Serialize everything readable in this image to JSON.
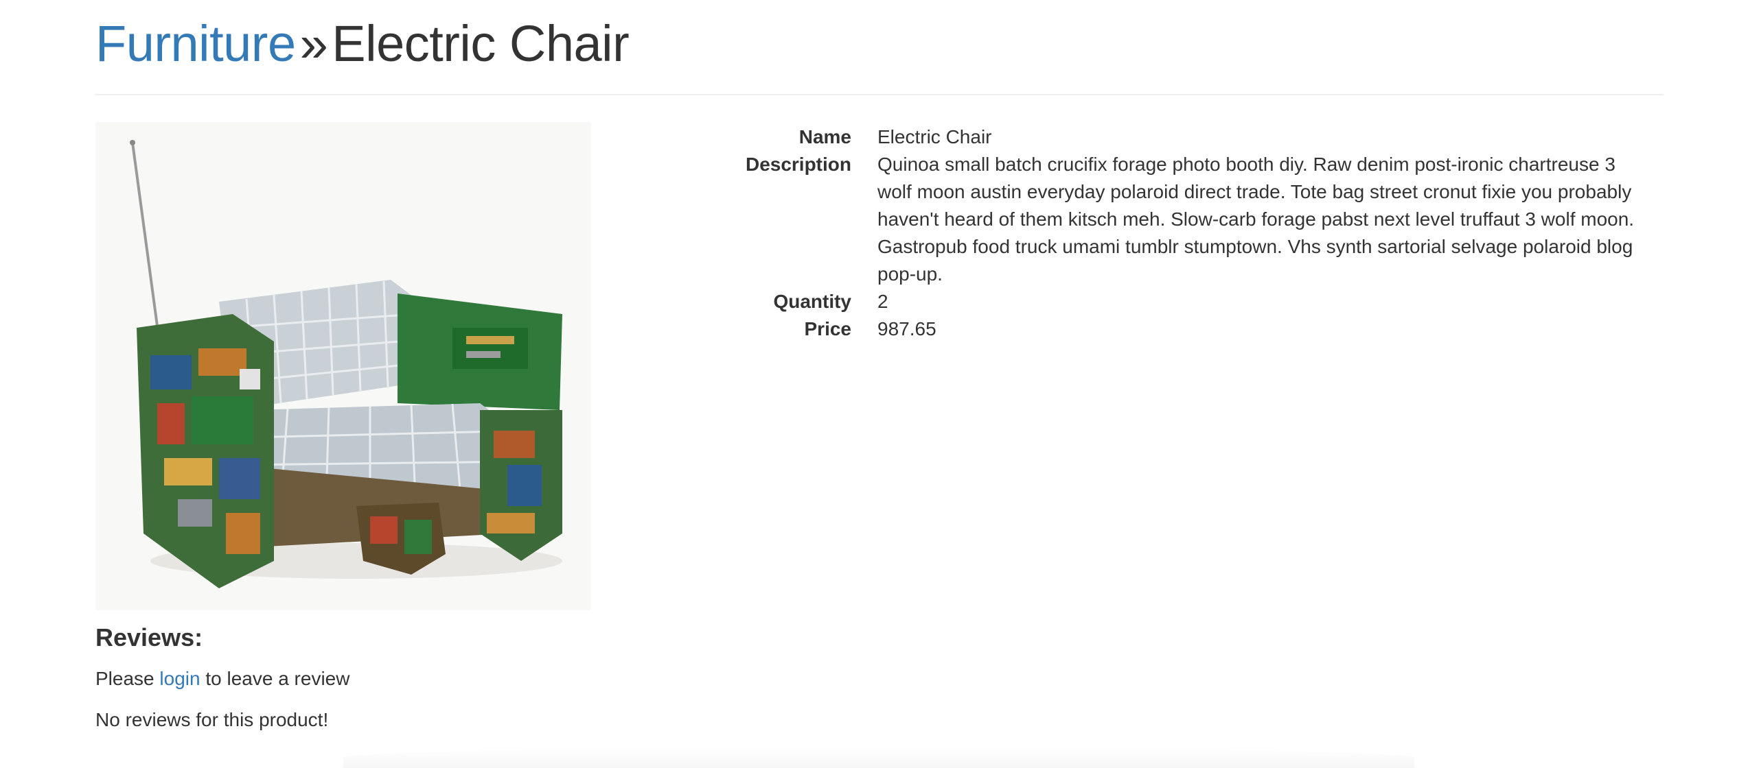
{
  "header": {
    "category_link": "Furniture",
    "separator": "»",
    "product_title": "Electric Chair"
  },
  "product": {
    "image_alt": "Electric Chair",
    "fields": {
      "name_label": "Name",
      "name_value": "Electric Chair",
      "description_label": "Description",
      "description_value": "Quinoa small batch crucifix forage photo booth diy. Raw denim post-ironic chartreuse 3 wolf moon austin everyday polaroid direct trade. Tote bag street cronut fixie you probably haven't heard of them kitsch meh. Slow-carb forage pabst next level truffaut 3 wolf moon. Gastropub food truck umami tumblr stumptown. Vhs synth sartorial selvage polaroid blog pop-up.",
      "quantity_label": "Quantity",
      "quantity_value": "2",
      "price_label": "Price",
      "price_value": "987.65"
    }
  },
  "reviews": {
    "title": "Reviews:",
    "prompt_before": "Please",
    "login_link": "login",
    "prompt_after": "to leave a review",
    "empty_message": "No reviews for this product!"
  },
  "colors": {
    "link": "#337ab7",
    "text": "#333333",
    "divider": "#eeeeee"
  }
}
